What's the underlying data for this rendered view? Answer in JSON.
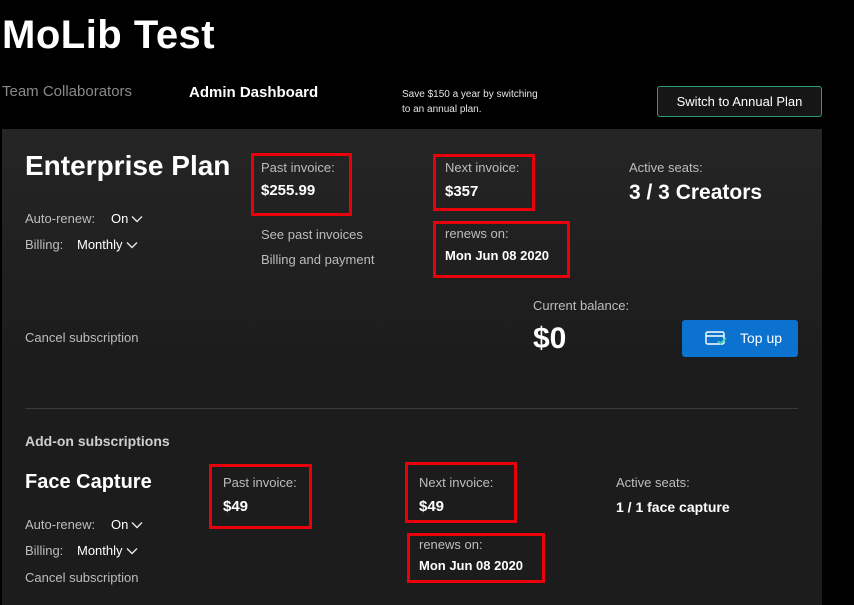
{
  "app": {
    "title": "MoLib Test"
  },
  "nav": {
    "tabs": [
      {
        "label": "Team Collaborators",
        "active": false
      },
      {
        "label": "Admin Dashboard",
        "active": true
      }
    ]
  },
  "promo": {
    "line1": "Save $150 a year by switching",
    "line2": "to an annual plan."
  },
  "annual_button": {
    "label": "Switch to Annual Plan"
  },
  "enterprise": {
    "title": "Enterprise Plan",
    "auto_renew_label": "Auto-renew:",
    "auto_renew_value": "On",
    "billing_label": "Billing:",
    "billing_value": "Monthly",
    "past_invoice_label": "Past invoice:",
    "past_invoice_value": "$255.99",
    "see_past_invoices": "See past invoices",
    "billing_and_payment": "Billing and payment",
    "next_invoice_label": "Next invoice:",
    "next_invoice_value": "$357",
    "renews_on_label": "renews on:",
    "renews_on_value": "Mon Jun 08 2020",
    "active_seats_label": "Active seats:",
    "active_seats_value": "3 / 3 Creators",
    "cancel_subscription": "Cancel subscription",
    "current_balance_label": "Current balance:",
    "current_balance_value": "$0",
    "top_up_label": "Top up"
  },
  "addons": {
    "section_title": "Add-on subscriptions",
    "face_capture": {
      "title": "Face Capture",
      "auto_renew_label": "Auto-renew:",
      "auto_renew_value": "On",
      "billing_label": "Billing:",
      "billing_value": "Monthly",
      "cancel_subscription": "Cancel subscription",
      "past_invoice_label": "Past invoice:",
      "past_invoice_value": "$49",
      "next_invoice_label": "Next invoice:",
      "next_invoice_value": "$49",
      "renews_on_label": "renews on:",
      "renews_on_value": "Mon Jun 08 2020",
      "active_seats_label": "Active seats:",
      "active_seats_value": "1 / 1 face capture"
    }
  },
  "colors": {
    "background": "#000000",
    "panel": "#1c1c1c",
    "accent_green": "#2e9c6e",
    "accent_blue": "#0b72cf",
    "highlight_red": "#e8000a",
    "muted_text": "#bdbdbd"
  },
  "icons": {
    "chevron": "chevron-down-icon",
    "card": "credit-card-icon"
  }
}
